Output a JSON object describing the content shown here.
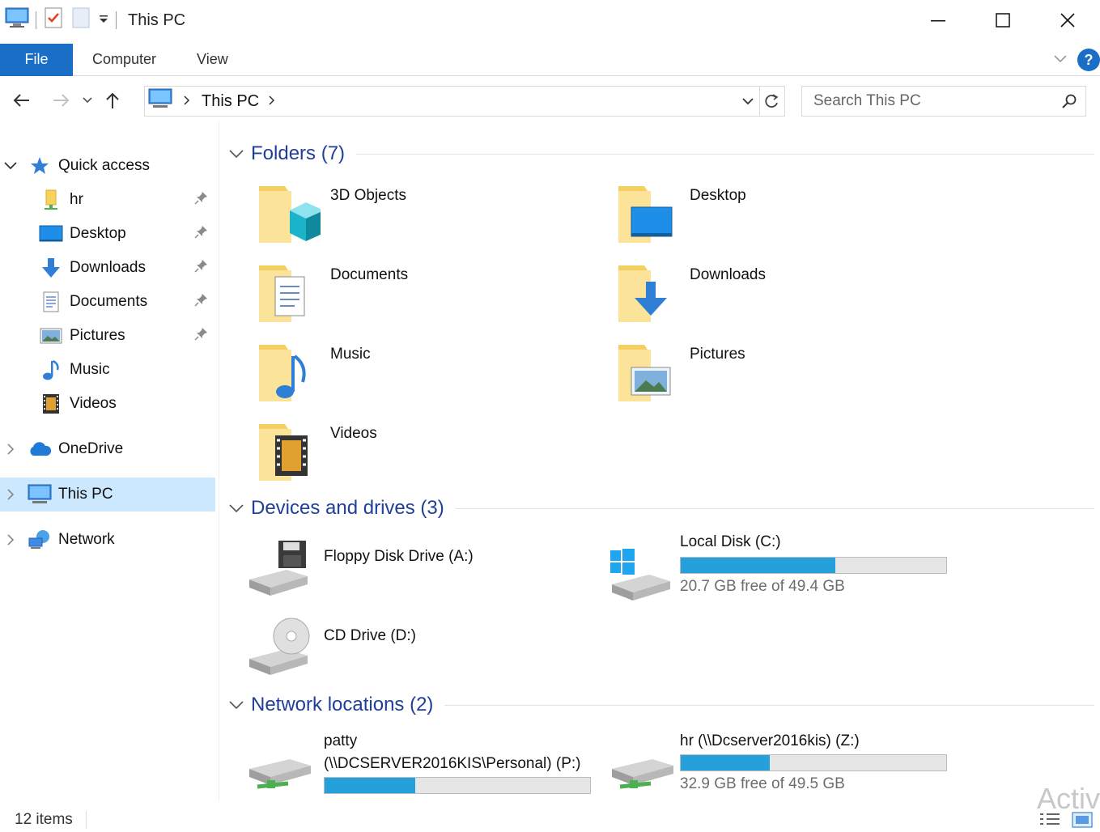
{
  "window": {
    "title": "This PC",
    "accent": "#1a6ec5",
    "selection": "#cce8ff"
  },
  "ribbon": {
    "file": "File",
    "tabs": [
      "Computer",
      "View"
    ],
    "help": "?"
  },
  "address": {
    "crumb": "This PC",
    "search_placeholder": "Search This PC"
  },
  "nav": {
    "quick_access": "Quick access",
    "quick_items": [
      {
        "label": "hr",
        "icon": "user-folder-icon",
        "pinned": true
      },
      {
        "label": "Desktop",
        "icon": "desktop-icon",
        "pinned": true
      },
      {
        "label": "Downloads",
        "icon": "download-arrow-icon",
        "pinned": true
      },
      {
        "label": "Documents",
        "icon": "document-icon",
        "pinned": true
      },
      {
        "label": "Pictures",
        "icon": "picture-icon",
        "pinned": true
      },
      {
        "label": "Music",
        "icon": "music-note-icon",
        "pinned": false
      },
      {
        "label": "Videos",
        "icon": "film-icon",
        "pinned": false
      }
    ],
    "onedrive": "OneDrive",
    "this_pc": "This PC",
    "network": "Network"
  },
  "groups": {
    "folders": {
      "title": "Folders (7)",
      "items": [
        "3D Objects",
        "Desktop",
        "Documents",
        "Downloads",
        "Music",
        "Pictures",
        "Videos"
      ]
    },
    "devices": {
      "title": "Devices and drives (3)",
      "floppy": "Floppy Disk Drive (A:)",
      "local_disk": {
        "label": "Local Disk (C:)",
        "free": "20.7 GB free of 49.4 GB",
        "used_fraction": 0.581
      },
      "cd": "CD Drive (D:)"
    },
    "network": {
      "title": "Network locations (2)",
      "patty": {
        "line1": "patty",
        "line2": "(\\\\DCSERVER2016KIS\\Personal) (P:)",
        "used_fraction": 0.34
      },
      "hr": {
        "label": "hr (\\\\Dcserver2016kis) (Z:)",
        "free": "32.9 GB free of 49.5 GB",
        "used_fraction": 0.335
      }
    }
  },
  "status": {
    "count": "12 items",
    "watermark": "Activ"
  }
}
